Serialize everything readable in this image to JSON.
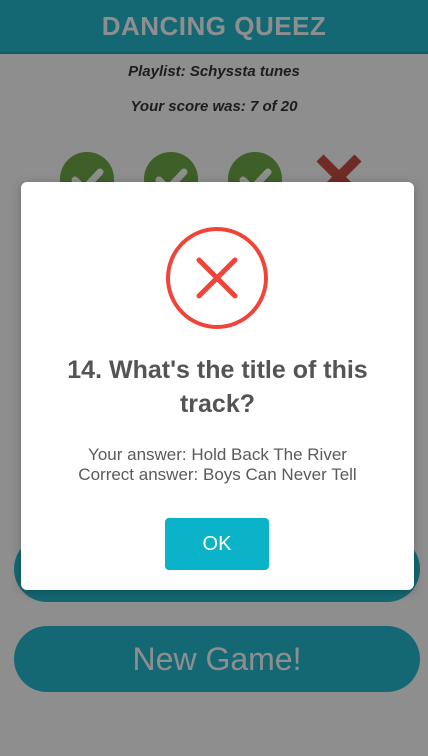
{
  "header": {
    "title": "DANCING QUEEZ"
  },
  "info": {
    "playlist": "Playlist: Schyssta tunes",
    "score": "Your score was: 7 of 20"
  },
  "results": [
    {
      "icon": "check-icon",
      "correct": true
    },
    {
      "icon": "check-icon",
      "correct": true
    },
    {
      "icon": "check-icon",
      "correct": true
    },
    {
      "icon": "cross-icon",
      "correct": false
    }
  ],
  "buttons": {
    "new_game": "New Game!"
  },
  "modal": {
    "icon": "error-x-icon",
    "question": "14. What's the title of this track?",
    "your_answer": "Your answer: Hold Back The River",
    "correct_answer": "Correct answer: Boys Can Never Tell",
    "ok_label": "OK"
  },
  "colors": {
    "accent": "#0bb3c9",
    "correct": "#5fa233",
    "wrong": "#c0392b",
    "error_icon": "#f0443a"
  }
}
